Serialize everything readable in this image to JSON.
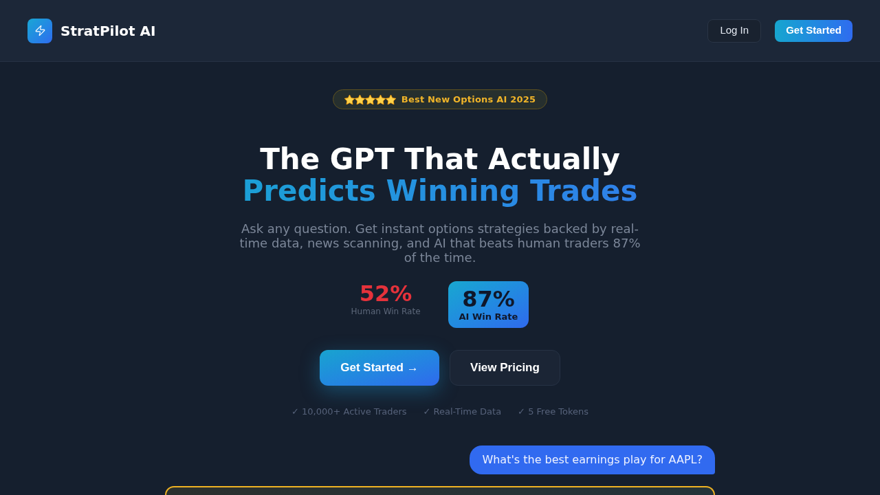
{
  "header": {
    "brand": "StratPilot AI",
    "buttons": [
      {
        "label": "Log In",
        "kind": "outline"
      },
      {
        "label": "Get Started",
        "kind": "primary"
      }
    ]
  },
  "hero": {
    "badge": {
      "stars": 5,
      "text": "Best New Options AI 2025"
    },
    "title": {
      "line_1": "The GPT That Actually",
      "line_2": "Predicts Winning Trades"
    },
    "subtitle": "Ask any question. Get instant options strategies backed by real-time data, news scanning, and AI that beats human traders 87% of the time.",
    "stats": [
      {
        "value": "52%",
        "label": "Human Win Rate",
        "kind": "plain"
      },
      {
        "value": "87%",
        "label": "AI Win Rate",
        "kind": "highlight"
      }
    ],
    "buttons": [
      {
        "label": "Get Started →",
        "kind": "primary"
      },
      {
        "label": "View Pricing",
        "kind": "secondary"
      }
    ],
    "features": [
      "✓ 10,000+ Active Traders",
      "✓ Real-Time Data",
      "✓ 5 Free Tokens"
    ]
  },
  "chat": {
    "user_message": "What's the best earnings play for AAPL?"
  }
}
